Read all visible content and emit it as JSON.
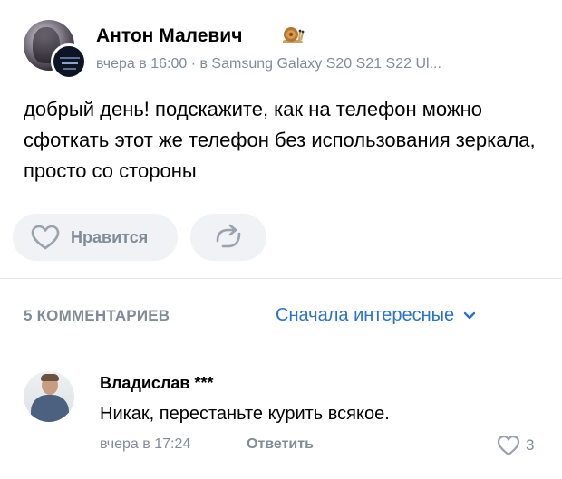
{
  "post": {
    "author": "Антон Малевич",
    "time": "вчера в 16:00",
    "source": "в Samsung Galaxy S20 S21 S22 Ul...",
    "text": "добрый день! подскажите, как на телефон можно сфоткать этот же телефон без использования зеркала, просто со стороны",
    "like_label": "Нравится"
  },
  "comments_header": {
    "count_label": "5 КОММЕНТАРИЕВ",
    "sort_label": "Сначала интересные"
  },
  "comment": {
    "author": "Владислав ***",
    "text": "Никак, перестаньте курить всякое.",
    "time": "вчера в 17:24",
    "reply_label": "Ответить",
    "likes": "3"
  },
  "icons": {
    "author_badge": "snail-emoji",
    "like": "heart-outline-icon",
    "share": "share-arrow-icon",
    "sort": "chevron-down-icon"
  },
  "colors": {
    "accent": "#2a73c6",
    "secondary_text": "#818c99",
    "button_bg": "#f0f2f5"
  }
}
